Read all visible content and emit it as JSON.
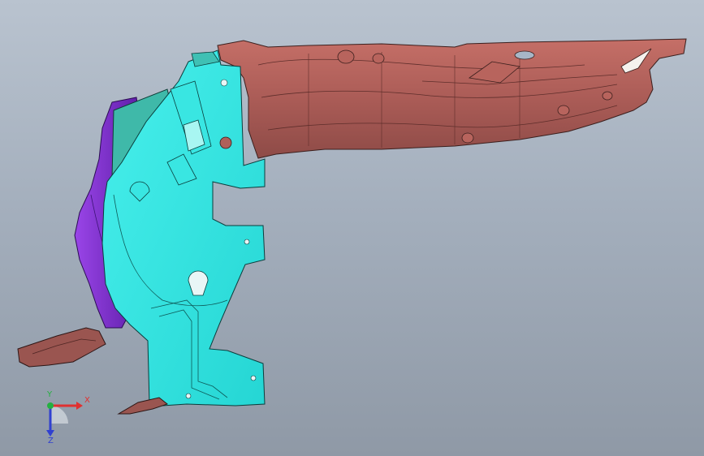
{
  "viewport": {
    "background_top": "#b9c3cf",
    "background_bottom": "#8f99a6"
  },
  "parts": [
    {
      "name": "upper-brown-rail",
      "color": "#b0605a"
    },
    {
      "name": "cyan-bracket",
      "color": "#2ee6e3"
    },
    {
      "name": "purple-panel",
      "color": "#7a2bd0"
    },
    {
      "name": "teal-insert",
      "color": "#3fb9a9"
    },
    {
      "name": "lower-left-brown-piece",
      "color": "#9a5550"
    }
  ],
  "triad": {
    "x_label": "X",
    "y_label": "Y",
    "z_label": "Z",
    "x_color": "#e03030",
    "y_color": "#24b040",
    "z_color": "#3040d0"
  }
}
